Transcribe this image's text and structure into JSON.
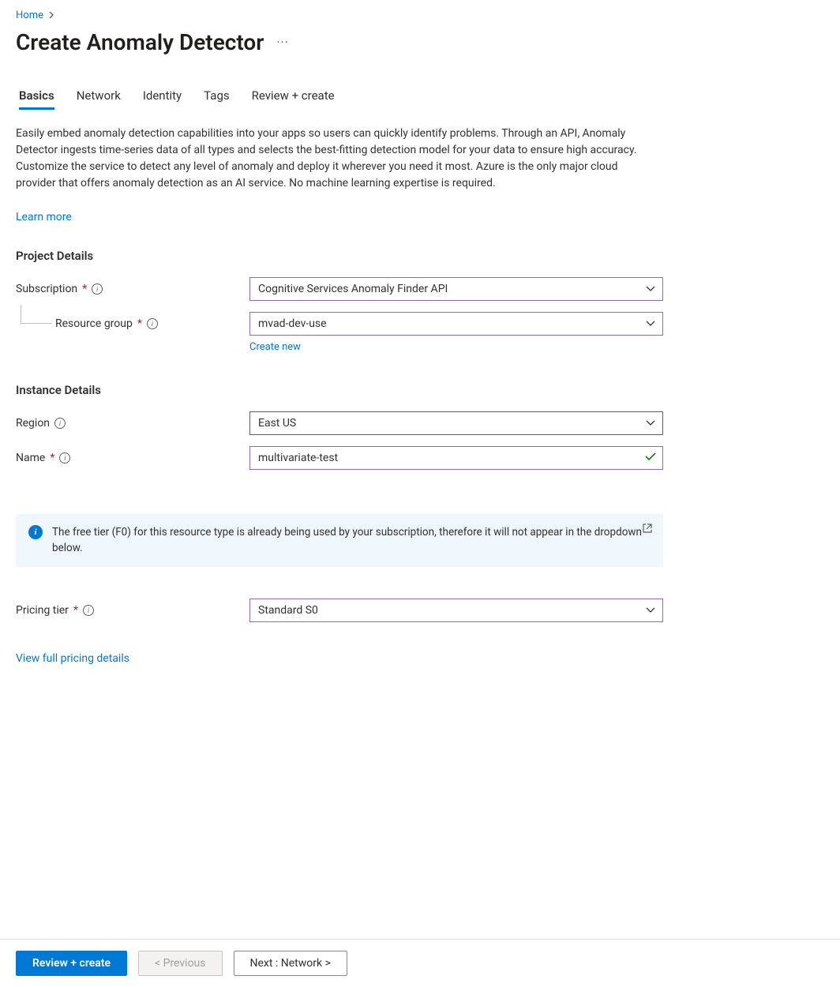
{
  "breadcrumb": {
    "home": "Home"
  },
  "pageTitle": "Create Anomaly Detector",
  "tabs": {
    "basics": "Basics",
    "network": "Network",
    "identity": "Identity",
    "tags": "Tags",
    "review": "Review + create"
  },
  "description": "Easily embed anomaly detection capabilities into your apps so users can quickly identify problems. Through an API, Anomaly Detector ingests time-series data of all types and selects the best-fitting detection model for your data to ensure high accuracy. Customize the service to detect any level of anomaly and deploy it wherever you need it most. Azure is the only major cloud provider that offers anomaly detection as an AI service. No machine learning expertise is required.",
  "learnMore": "Learn more",
  "sections": {
    "project": "Project Details",
    "instance": "Instance Details"
  },
  "labels": {
    "subscription": "Subscription",
    "resourceGroup": "Resource group",
    "region": "Region",
    "name": "Name",
    "pricingTier": "Pricing tier"
  },
  "values": {
    "subscription": "Cognitive Services Anomaly Finder API",
    "resourceGroup": "mvad-dev-use",
    "region": "East US",
    "name": "multivariate-test",
    "pricingTier": "Standard S0"
  },
  "links": {
    "createNew": "Create new",
    "pricingDetails": "View full pricing details"
  },
  "banner": {
    "text": "The free tier (F0) for this resource type is already being used by your subscription, therefore it will not appear in the dropdown below."
  },
  "buttons": {
    "review": "Review + create",
    "previous": "< Previous",
    "next": "Next : Network >"
  }
}
